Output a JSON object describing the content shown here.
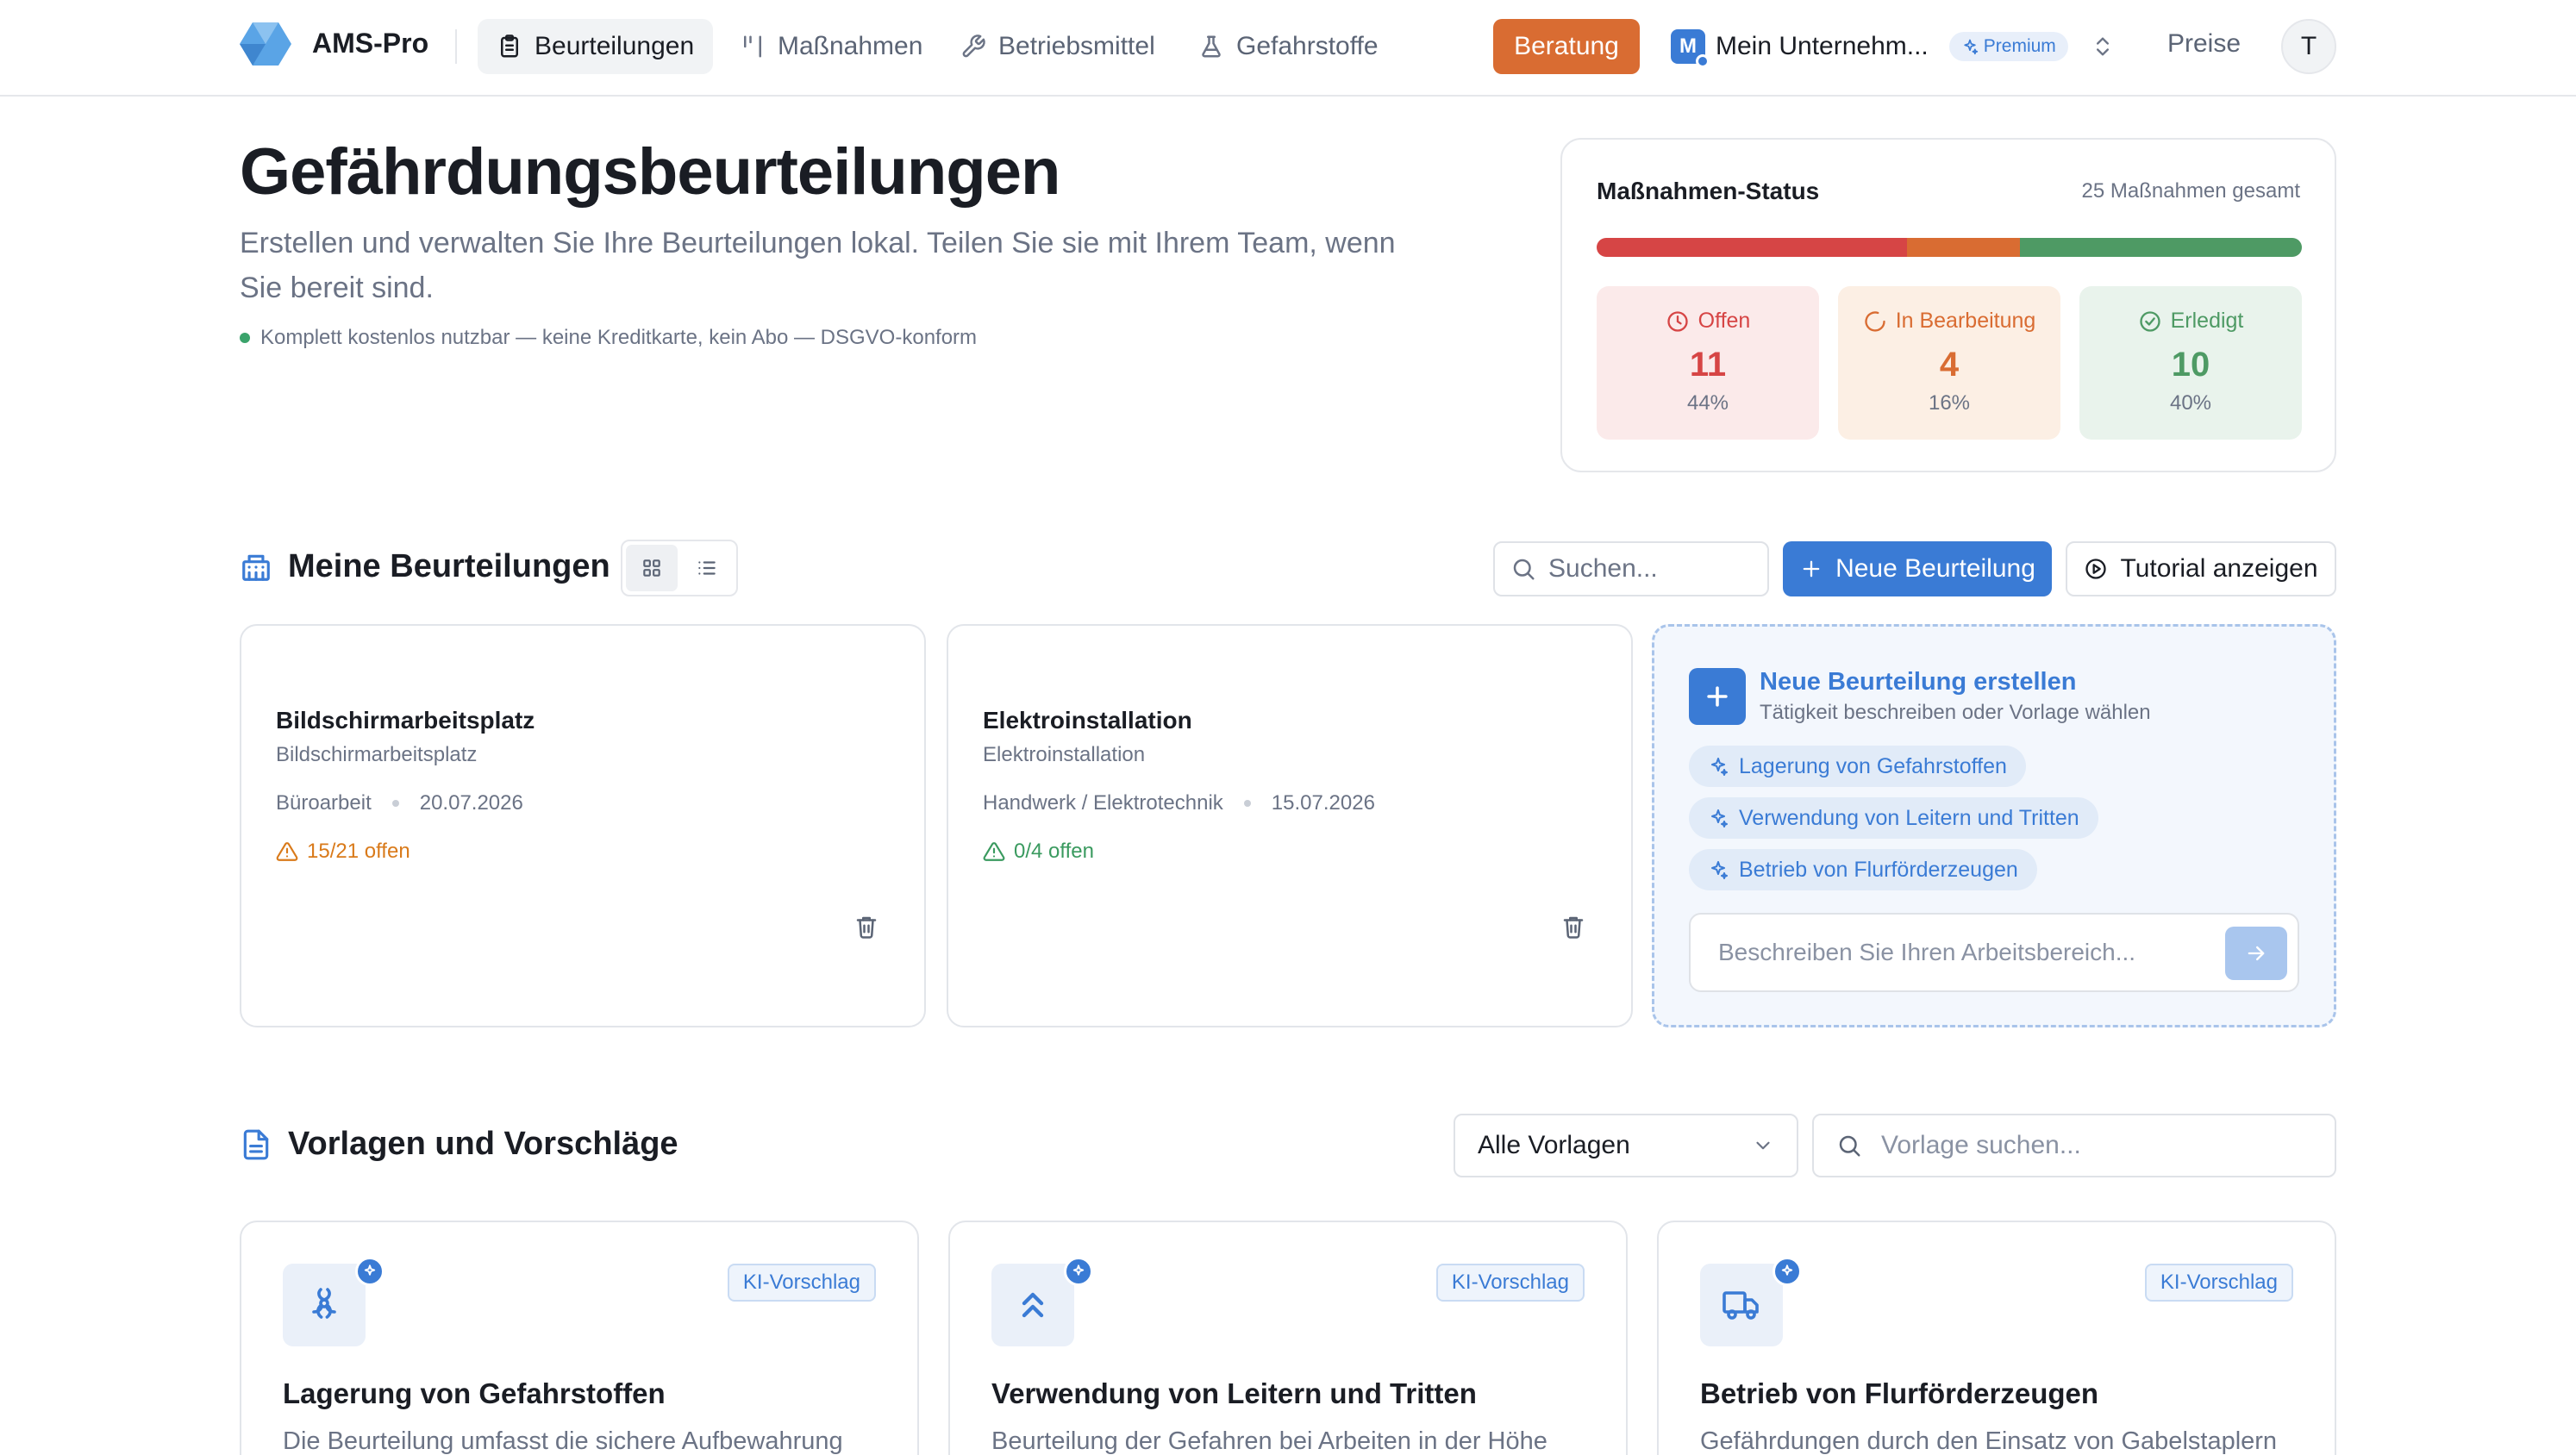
{
  "header": {
    "brand": "AMS-Pro",
    "nav": [
      {
        "label": "Beurteilungen",
        "icon": "clipboard-icon",
        "active": true
      },
      {
        "label": "Maßnahmen",
        "icon": "bars-icon",
        "active": false
      },
      {
        "label": "Betriebsmittel",
        "icon": "wrench-icon",
        "active": false
      },
      {
        "label": "Gefahrstoffe",
        "icon": "flask-icon",
        "active": false
      }
    ],
    "consult_label": "Beratung",
    "org": {
      "initial": "M",
      "name": "Mein Unternehm...",
      "plan": "Premium"
    },
    "pricing_label": "Preise",
    "user_initial": "T"
  },
  "hero": {
    "title": "Gefährdungsbeurteilungen",
    "subtitle": "Erstellen und verwalten Sie Ihre Beurteilungen lokal. Teilen Sie sie mit Ihrem Team, wenn Sie bereit sind.",
    "note": "Komplett kostenlos nutzbar — keine Kreditkarte, kein Abo — DSGVO-konform"
  },
  "status": {
    "title": "Maßnahmen-Status",
    "total_label": "25 Maßnahmen gesamt",
    "items": [
      {
        "label": "Offen",
        "count": "11",
        "percent": "44%",
        "fraction": 0.44,
        "color": "#d64545"
      },
      {
        "label": "In Bearbeitung",
        "count": "4",
        "percent": "16%",
        "fraction": 0.16,
        "color": "#d96c32"
      },
      {
        "label": "Erledigt",
        "count": "10",
        "percent": "40%",
        "fraction": 0.4,
        "color": "#4e9a64"
      }
    ]
  },
  "assessments": {
    "title": "Meine Beurteilungen",
    "search_placeholder": "Suchen...",
    "new_label": "Neue Beurteilung",
    "tutorial_label": "Tutorial anzeigen",
    "cards": [
      {
        "title": "Bildschirmarbeitsplatz",
        "subtitle": "Bildschirmarbeitsplatz",
        "category": "Büroarbeit",
        "date": "20.07.2026",
        "open": "15/21 offen",
        "open_color": "#d97a1a"
      },
      {
        "title": "Elektroinstallation",
        "subtitle": "Elektroinstallation",
        "category": "Handwerk / Elektrotechnik",
        "date": "15.07.2026",
        "open": "0/4 offen",
        "open_color": "#3a9a5f"
      }
    ],
    "new_card": {
      "title": "Neue Beurteilung erstellen",
      "subtitle": "Tätigkeit beschreiben oder Vorlage wählen",
      "suggestions": [
        "Lagerung von Gefahrstoffen",
        "Verwendung von Leitern und Tritten",
        "Betrieb von Flurförderzeugen"
      ],
      "input_placeholder": "Beschreiben Sie Ihren Arbeitsbereich..."
    }
  },
  "templates": {
    "title": "Vorlagen und Vorschläge",
    "filter_value": "Alle Vorlagen",
    "search_placeholder": "Vorlage suchen...",
    "cards": [
      {
        "badge": "KI-Vorschlag",
        "title": "Lagerung von Gefahrstoffen",
        "description": "Die Beurteilung umfasst die sichere Aufbewahrung",
        "icon": "biohazard-icon"
      },
      {
        "badge": "KI-Vorschlag",
        "title": "Verwendung von Leitern und Tritten",
        "description": "Beurteilung der Gefahren bei Arbeiten in der Höhe",
        "icon": "chevrons-up-icon"
      },
      {
        "badge": "KI-Vorschlag",
        "title": "Betrieb von Flurförderzeugen",
        "description": "Gefährdungen durch den Einsatz von Gabelstaplern",
        "icon": "truck-icon"
      }
    ]
  }
}
